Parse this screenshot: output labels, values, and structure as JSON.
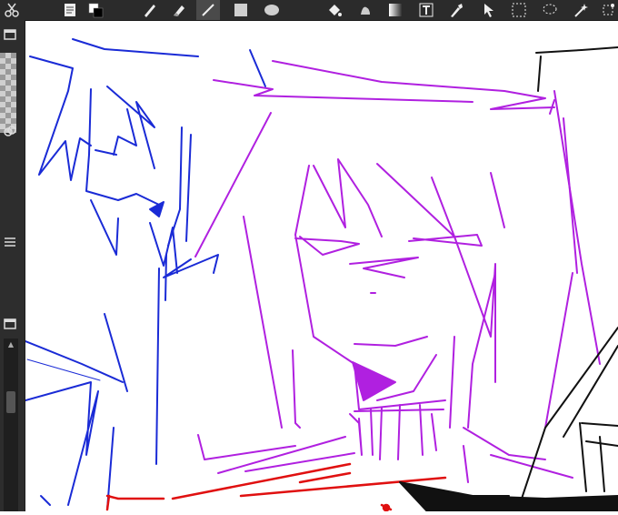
{
  "toolbar": {
    "tools": [
      {
        "name": "scissors-icon",
        "glyph": "✂"
      },
      {
        "name": "notes-icon",
        "glyph": ""
      },
      {
        "name": "color-swatch-icon",
        "glyph": ""
      },
      {
        "name": "pen-tool-icon",
        "glyph": ""
      },
      {
        "name": "eraser-tool-icon",
        "glyph": ""
      },
      {
        "name": "line-tool-icon",
        "glyph": ""
      },
      {
        "name": "rectangle-tool-icon",
        "glyph": ""
      },
      {
        "name": "ellipse-tool-icon",
        "glyph": ""
      },
      {
        "name": "fill-bucket-icon",
        "glyph": ""
      },
      {
        "name": "blend-tool-icon",
        "glyph": ""
      },
      {
        "name": "gradient-tool-icon",
        "glyph": ""
      },
      {
        "name": "text-tool-icon",
        "glyph": ""
      },
      {
        "name": "eyedropper-tool-icon",
        "glyph": ""
      },
      {
        "name": "select-arrow-icon",
        "glyph": ""
      },
      {
        "name": "rect-select-icon",
        "glyph": ""
      },
      {
        "name": "lasso-select-icon",
        "glyph": ""
      },
      {
        "name": "magic-wand-icon",
        "glyph": ""
      },
      {
        "name": "more-tools-icon",
        "glyph": ""
      }
    ],
    "active_tool": "line-tool-icon",
    "primary_color": "#000000",
    "secondary_color": "#ffffff"
  },
  "colors": {
    "ui_bg": "#2b2b2b",
    "blue_stroke": "#1a2bd6",
    "purple_stroke": "#b020e0",
    "red_stroke": "#e01010",
    "black_stroke": "#111111"
  }
}
